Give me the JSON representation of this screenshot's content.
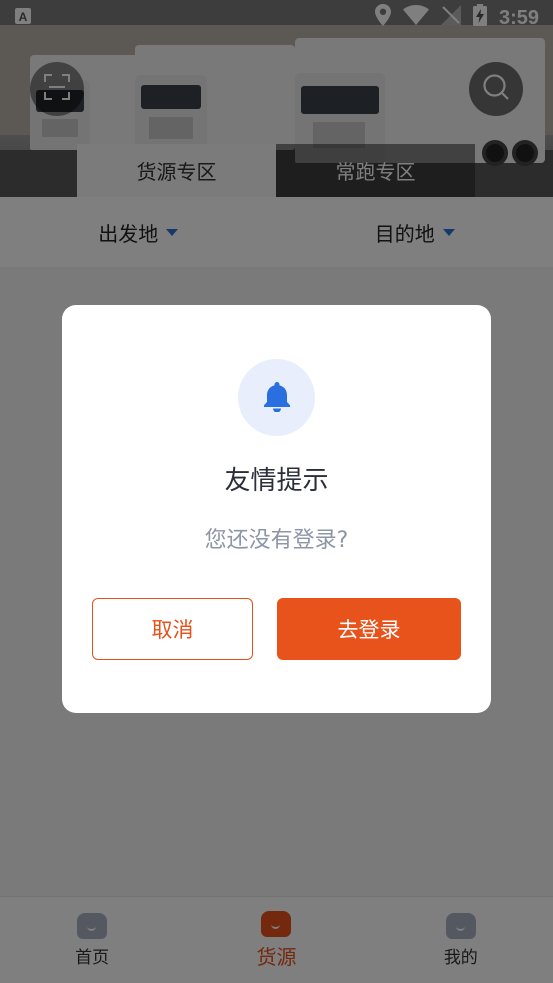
{
  "status_bar": {
    "time": "3:59",
    "icons": [
      "notification-a-icon",
      "location-icon",
      "wifi-icon",
      "signal-icon",
      "battery-charging-icon"
    ]
  },
  "header": {
    "scan_icon": "scan-icon",
    "search_icon": "search-icon",
    "tabs": [
      {
        "label": "货源专区",
        "active": true
      },
      {
        "label": "常跑专区",
        "active": false
      }
    ]
  },
  "filters": {
    "origin": "出发地",
    "destination": "目的地"
  },
  "dialog": {
    "icon": "bell-icon",
    "title": "友情提示",
    "message": "您还没有登录?",
    "cancel_label": "取消",
    "login_label": "去登录"
  },
  "tabbar": {
    "items": [
      {
        "label": "首页",
        "active": false
      },
      {
        "label": "货源",
        "active": true
      },
      {
        "label": "我的",
        "active": false
      }
    ]
  },
  "colors": {
    "accent": "#e8531c",
    "bell_blue": "#2a6fe0",
    "bell_bg": "#e8eefb",
    "caret_blue": "#2c73d8",
    "tab_icon_gray": "#a9b3c3"
  }
}
